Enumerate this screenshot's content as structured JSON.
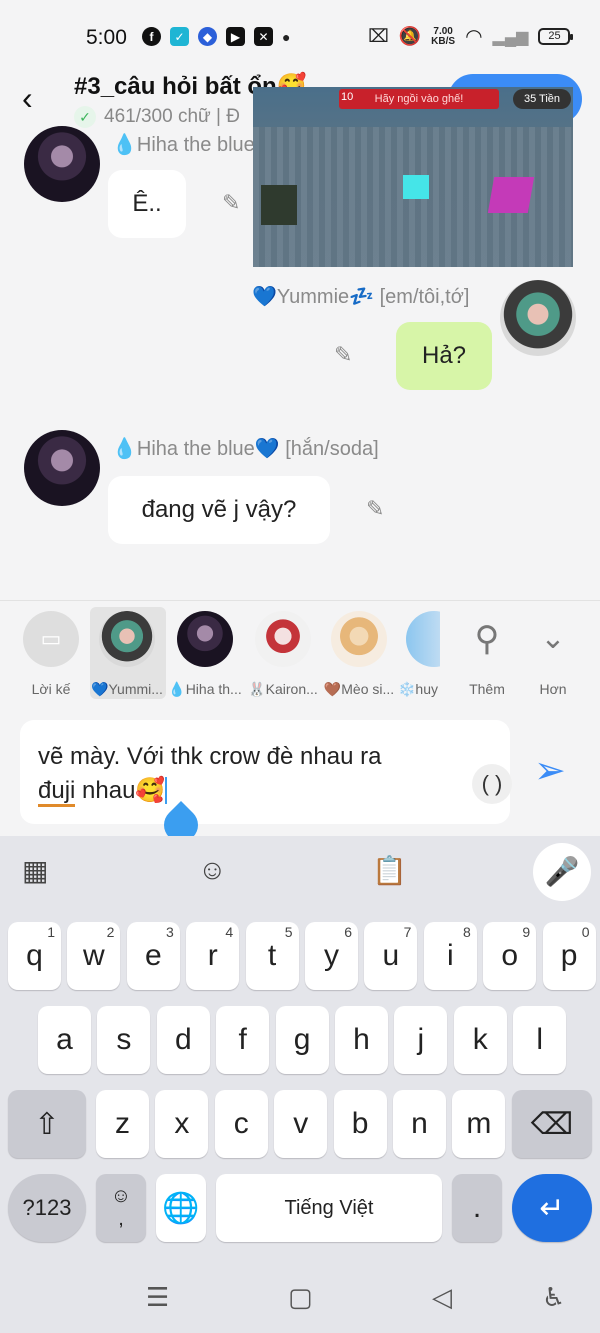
{
  "status": {
    "time": "5:00",
    "net_speed_top": "7.00",
    "net_speed_bottom": "KB/S",
    "battery": "25"
  },
  "header": {
    "title": "#3_câu hỏi bất ổn",
    "subtitle": "461/300 chữ | Đ"
  },
  "chat": {
    "messages": [
      {
        "sender": "💧Hiha the blue",
        "text": "Ê.."
      },
      {
        "sender": "💙Yummie💤 [em/tôi,tớ]",
        "text": "Hả?"
      },
      {
        "sender": "💧Hiha the blue💙 [hắn/soda]",
        "text": "đang vẽ j vậy?"
      }
    ],
    "video": {
      "count": "10",
      "banner": "Hãy ngồi vào ghế!",
      "tag": "35 Tiền"
    }
  },
  "reply_bar": {
    "items": [
      {
        "label": "Lời kế"
      },
      {
        "label": "💙Yummi..."
      },
      {
        "label": "💧Hiha th..."
      },
      {
        "label": "🐰Kairon..."
      },
      {
        "label": "🤎Mèo si..."
      },
      {
        "label": "❄️huy"
      }
    ],
    "more_label": "Thêm",
    "expand_label": "Hơn"
  },
  "input": {
    "line1": "vẽ mày. Với thk crow đè nhau ra",
    "underlined": "đuji",
    "line2_rest": " nhau🥰",
    "parens": "( )"
  },
  "keyboard": {
    "row1": [
      {
        "key": "q",
        "hint": "1"
      },
      {
        "key": "w",
        "hint": "2"
      },
      {
        "key": "e",
        "hint": "3"
      },
      {
        "key": "r",
        "hint": "4"
      },
      {
        "key": "t",
        "hint": "5"
      },
      {
        "key": "y",
        "hint": "6"
      },
      {
        "key": "u",
        "hint": "7"
      },
      {
        "key": "i",
        "hint": "8"
      },
      {
        "key": "o",
        "hint": "9"
      },
      {
        "key": "p",
        "hint": "0"
      }
    ],
    "row2": [
      "a",
      "s",
      "d",
      "f",
      "g",
      "h",
      "j",
      "k",
      "l"
    ],
    "row3": [
      "z",
      "x",
      "c",
      "v",
      "b",
      "n",
      "m"
    ],
    "symbols_key": "?123",
    "emoji_key_sub": ",",
    "space_label": "Tiếng Việt",
    "period_key": "."
  }
}
